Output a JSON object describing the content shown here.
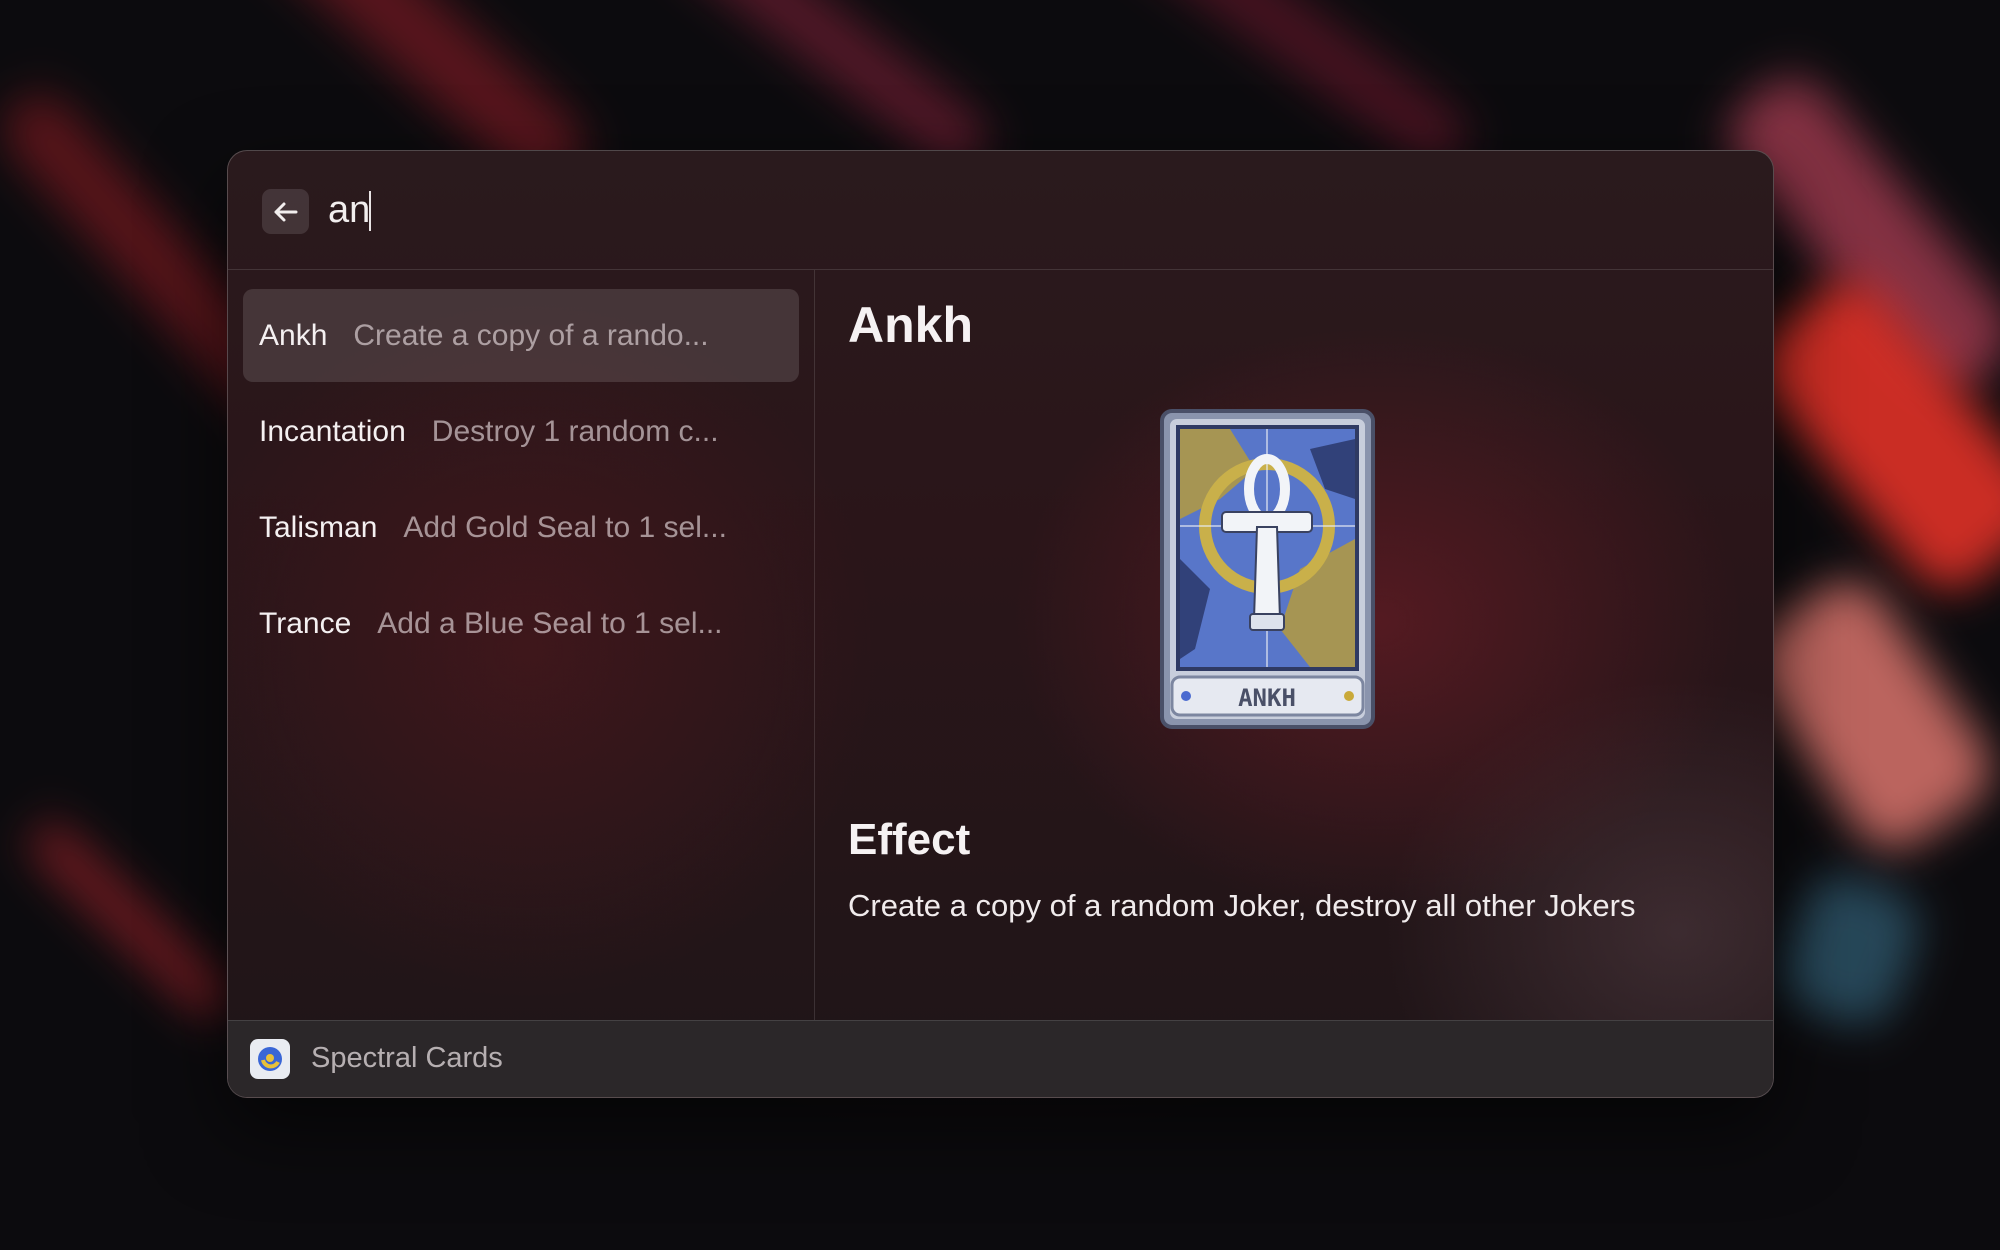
{
  "search": {
    "value": "an",
    "back_icon": "arrow-left-icon"
  },
  "results": [
    {
      "title": "Ankh",
      "subtitle": "Create a copy of a rando...",
      "selected": true
    },
    {
      "title": "Incantation",
      "subtitle": "Destroy 1 random c...",
      "selected": false
    },
    {
      "title": "Talisman",
      "subtitle": "Add Gold Seal to 1 sel...",
      "selected": false
    },
    {
      "title": "Trance",
      "subtitle": "Add a Blue Seal to 1 sel...",
      "selected": false
    }
  ],
  "detail": {
    "title": "Ankh",
    "card_label": "ANKH",
    "effect_heading": "Effect",
    "effect_text": "Create a copy of a random Joker, destroy all other Jokers"
  },
  "footer": {
    "label": "Spectral Cards",
    "icon": "spectral-cards-logo-icon"
  },
  "colors": {
    "accent_red": "#e2322b",
    "card_blue": "#5876c9",
    "card_gold": "#b49b3e"
  }
}
